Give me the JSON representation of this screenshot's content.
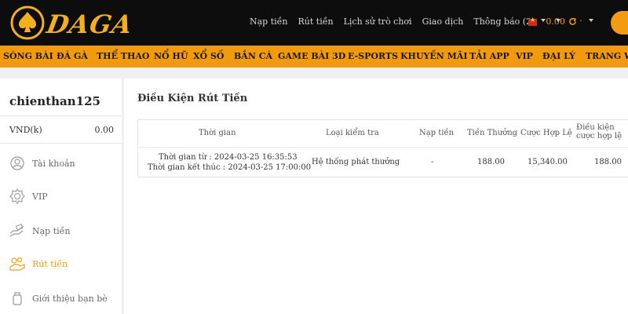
{
  "header": {
    "logo_text": "DAGA",
    "links": [
      "Nạp tiền",
      "Rút tiền",
      "Lịch sử trò chơi",
      "Giao dịch",
      "Thông báo (2)"
    ],
    "balance": "0.00",
    "dots": "·  ·"
  },
  "nav": {
    "items": [
      "SÒNG BÀI",
      "ĐÁ GÀ",
      "THỂ THAO",
      "NỔ HŨ",
      "XỔ SỐ",
      "BẮN CÁ",
      "GAME BÀI 3D",
      "E-SPORTS",
      "KHUYẾN MÃI",
      "TẢI APP",
      "VIP",
      "ĐẠI LÝ",
      "TRANG WEB"
    ]
  },
  "sidebar": {
    "username": "chienthan125",
    "currency_label": "VND(k)",
    "currency_value": "0.00",
    "items": [
      {
        "label": "Tài khoản",
        "icon": "account-icon"
      },
      {
        "label": "VIP",
        "icon": "vip-badge-icon"
      },
      {
        "label": "Nạp tiền",
        "icon": "deposit-hand-icon"
      },
      {
        "label": "Rút tiền",
        "icon": "withdraw-coins-icon",
        "active": true
      },
      {
        "label": "Giới thiệu bạn bè",
        "icon": "referral-icon"
      }
    ]
  },
  "main": {
    "title": "Điều Kiện Rút Tiền",
    "table": {
      "headers": [
        "Thời gian",
        "Loại kiểm tra",
        "Nạp tiền",
        "Tiền Thưởng",
        "Cược Hợp Lệ",
        "Điều kiện cược hợp lệ"
      ],
      "rows": [
        {
          "time_from": "Thời gian từ : 2024-03-25 16:35:53",
          "time_to": "Thời gian kết thúc : 2024-03-25 17:00:00",
          "check_type": "Hệ thống phát thưởng",
          "deposit": "-",
          "bonus": "188.00",
          "valid_bet": "15,340.00",
          "valid_bet_condition": "188.00"
        }
      ]
    }
  },
  "colors": {
    "accent": "#f29a0e",
    "header_bg": "#0d0d0d",
    "active": "#f39c12"
  }
}
